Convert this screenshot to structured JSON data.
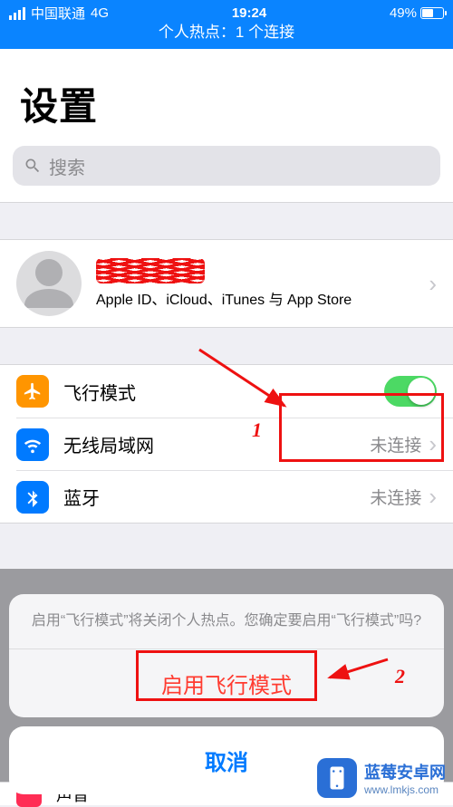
{
  "status": {
    "carrier": "中国联通",
    "network": "4G",
    "time": "19:24",
    "battery_pct": "49%",
    "hotspot_banner": "个人热点：1 个连接"
  },
  "page": {
    "title": "设置",
    "search_placeholder": "搜索"
  },
  "account": {
    "subtitle": "Apple ID、iCloud、iTunes 与 App Store"
  },
  "rows": {
    "airplane": {
      "label": "飞行模式",
      "on": true
    },
    "wifi": {
      "label": "无线局域网",
      "value": "未连接"
    },
    "bluetooth": {
      "label": "蓝牙",
      "value": "未连接"
    },
    "sound": {
      "label": "声音"
    }
  },
  "sheet": {
    "message": "启用“飞行模式”将关闭个人热点。您确定要启用“飞行模式”吗?",
    "action": "启用飞行模式",
    "cancel": "取消"
  },
  "annotations": {
    "num1": "1",
    "num2": "2"
  },
  "watermark": {
    "name": "蓝莓安卓网",
    "url": "www.lmkjs.com"
  },
  "colors": {
    "accent_blue": "#0a84ff",
    "switch_green": "#4cd964",
    "destructive": "#ff3b30",
    "annotation_red": "#e11"
  }
}
